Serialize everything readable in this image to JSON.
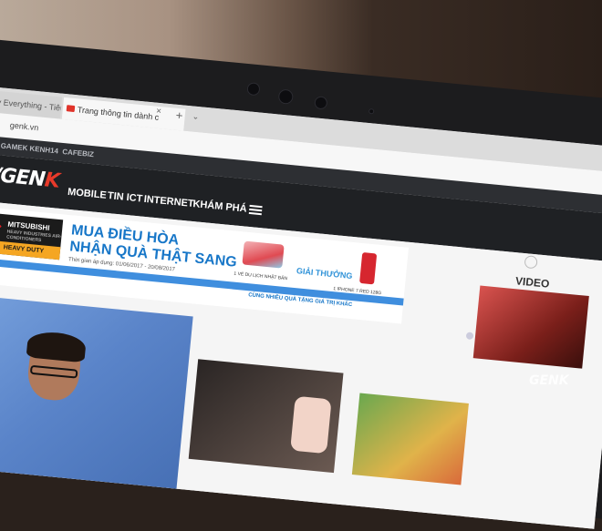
{
  "browser": {
    "tabs": [
      {
        "label": "My Everything - Tiêu Tr"
      },
      {
        "label": "Trang thông tin dành c"
      }
    ],
    "tab_close": "×",
    "new_tab": "+",
    "tab_menu": "⌄",
    "reload_icon": "↻",
    "url": "genk.vn"
  },
  "site": {
    "sister_sites": [
      "GAMEK",
      "KENH14",
      "CAFEBIZ"
    ],
    "logo": {
      "prefix": "/GEN",
      "accent": "K"
    },
    "nav": [
      "MOBILE",
      "TIN ICT",
      "INTERNET",
      "KHÁM PHÁ"
    ],
    "colors": {
      "brand_red": "#e83a2a",
      "nav_bg": "#1f2124",
      "ad_blue": "#1877c8"
    }
  },
  "ad": {
    "brand": "MITSUBISHI",
    "brand_sub": "HEAVY INDUSTRIES AIR-CONDITIONERS",
    "badge": "HEAVY DUTY",
    "headline1": "MUA ĐIỀU HÒA",
    "headline2": "NHẬN QUÀ THẬT SANG",
    "dates": "Thời gian áp dụng: 01/06/2017 - 20/08/2017",
    "prize_title": "GIẢI THƯỞNG",
    "prize1": "1 VÉ DU LỊCH NHẬT BẢN",
    "prize2": "1 IPHONE 7 RED 128G",
    "more": "CÙNG NHIỀU QUÀ TẶNG GIÁ TRỊ KHÁC"
  },
  "sidebar": {
    "video_label": "VIDEO"
  },
  "watermark": "GENK"
}
